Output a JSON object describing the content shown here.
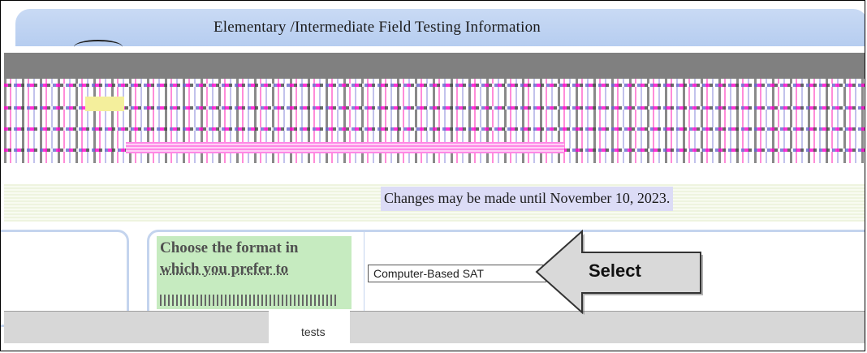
{
  "page": {
    "title": "Elementary /Intermediate Field Testing Information",
    "changes_notice": "Changes may be made until November 10, 2023."
  },
  "form": {
    "choose_label_line1": "Choose the format in",
    "choose_label_line2": "which you prefer to",
    "select_value": "Computer-Based SAT",
    "tests_fragment": "tests"
  },
  "callout": {
    "label": "Select",
    "icon": "left-arrow-icon"
  },
  "colors": {
    "title_bar": "#c9daf4",
    "label_cell": "#c6ebc0",
    "changes_highlight": "#dcdcf6",
    "arrow_fill": "#d9d9d9"
  }
}
